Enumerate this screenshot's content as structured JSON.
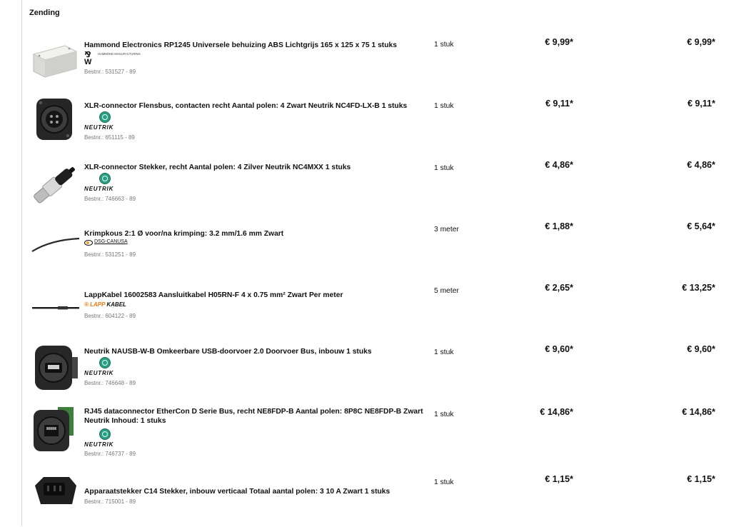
{
  "section": {
    "title": "Zending"
  },
  "items": [
    {
      "name": "Hammond Electronics RP1245 Universele behuizing ABS Lichtgrijs 165 x 125 x 75 1 stuks",
      "brand": "Hammond",
      "order_no": "Bestnr.: 531527 - 89",
      "quantity": "1 stuk",
      "unit_price": "€ 9,99*",
      "total_price": "€ 9,99*"
    },
    {
      "name": "XLR-connector Flensbus, contacten recht Aantal polen: 4 Zwart Neutrik NC4FD-LX-B 1 stuks",
      "brand": "Neutrik",
      "order_no": "Bestnr.: 651115 - 89",
      "quantity": "1 stuk",
      "unit_price": "€ 9,11*",
      "total_price": "€ 9,11*"
    },
    {
      "name": "XLR-connector Stekker, recht Aantal polen: 4 Zilver Neutrik NC4MXX 1 stuks",
      "brand": "Neutrik",
      "order_no": "Bestnr.: 746663 - 89",
      "quantity": "1 stuk",
      "unit_price": "€ 4,86*",
      "total_price": "€ 4,86*"
    },
    {
      "name": "Krimpkous 2:1 Ø voor/na krimping: 3.2 mm/1.6 mm Zwart",
      "brand": "DSG-Canusa",
      "order_no": "Bestnr.: 531251 - 89",
      "quantity": "3 meter",
      "unit_price": "€ 1,88*",
      "total_price": "€ 5,64*"
    },
    {
      "name": "LappKabel 16002583 Aansluitkabel H05RN-F 4 x 0.75 mm² Zwart Per meter",
      "brand": "LappKabel",
      "order_no": "Bestnr.: 604122 - 89",
      "quantity": "5 meter",
      "unit_price": "€ 2,65*",
      "total_price": "€ 13,25*"
    },
    {
      "name": "Neutrik NAUSB-W-B Omkeerbare USB-doorvoer 2.0 Doorvoer Bus, inbouw 1 stuks",
      "brand": "Neutrik",
      "order_no": "Bestnr.: 746648 - 89",
      "quantity": "1 stuk",
      "unit_price": "€ 9,60*",
      "total_price": "€ 9,60*"
    },
    {
      "name": "RJ45 dataconnector EtherCon D Serie Bus, recht NE8FDP-B Aantal polen: 8P8C NE8FDP-B Zwart Neutrik Inhoud: 1 stuks",
      "brand": "Neutrik",
      "order_no": "Bestnr.: 746737 - 89",
      "quantity": "1 stuk",
      "unit_price": "€ 14,86*",
      "total_price": "€ 14,86*"
    },
    {
      "name": "Apparaatstekker C14 Stekker, inbouw verticaal Totaal aantal polen: 3 10 A Zwart 1 stuks",
      "brand": "",
      "order_no": "Bestnr.: 715001 - 89",
      "quantity": "1 stuk",
      "unit_price": "€ 1,15*",
      "total_price": "€ 1,15*"
    }
  ],
  "logos": {
    "neutrik": "NEUTRIK",
    "hammond": "HAMMOND MANUFACTURING",
    "dsg": "DSG-CANUSA",
    "lapp_prefix": "® LAPP",
    "lapp_suffix": " KABEL"
  },
  "colors": {
    "neutrik_green": "#2a9f83",
    "lapp_orange": "#f0780a",
    "order_no_gray": "#777777"
  }
}
